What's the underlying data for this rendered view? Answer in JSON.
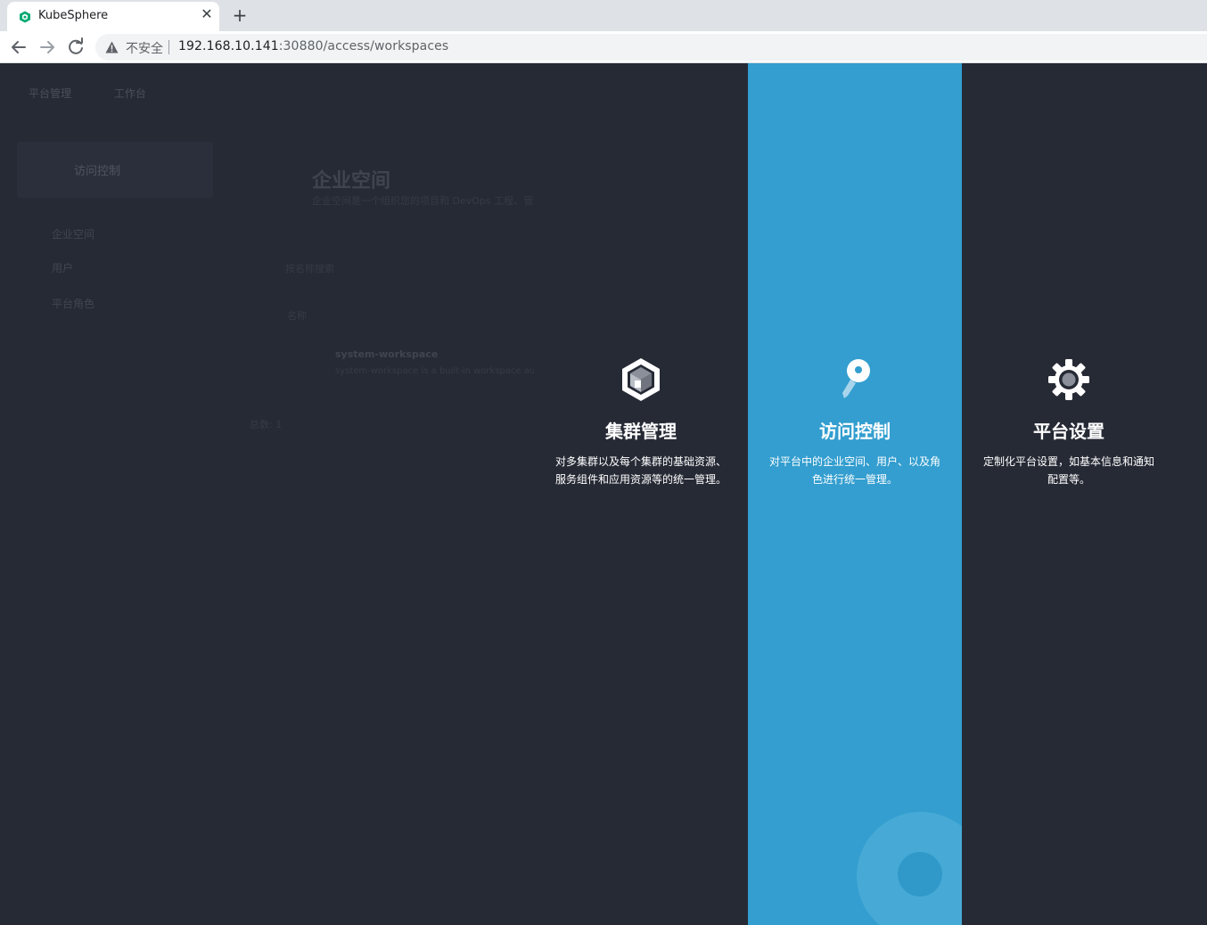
{
  "browser": {
    "tab_title": "KubeSphere",
    "tab_close": "✕",
    "new_tab": "+",
    "security_label": "不安全",
    "url_host": "192.168.10.141",
    "url_rest": ":30880/access/workspaces"
  },
  "background_app": {
    "top_nav": [
      "平台管理",
      "工作台"
    ],
    "sidebar_card": "访问控制",
    "sidebar_items": [
      "企业空间",
      "用户",
      "平台角色"
    ],
    "header_title": "企业空间",
    "header_desc": "企业空间是一个组织您的项目和 DevOps 工程、管理资源访问权限以及在团队内部共享资源等的逻辑单元，可以作为团队工作的独立工作空间。",
    "search_placeholder": "按名称搜索",
    "column_name": "名称",
    "row_name": "system-workspace",
    "row_desc": "system-workspace is a built-in workspace automatically created by KubeSphere.",
    "total": "总数: 1"
  },
  "panels": [
    {
      "icon": "cluster-cube-icon",
      "title": "集群管理",
      "description": "对多集群以及每个集群的基础资源、服务组件和应用资源等的统一管理。"
    },
    {
      "icon": "key-icon",
      "title": "访问控制",
      "description": "对平台中的企业空间、用户、以及角色进行统一管理。"
    },
    {
      "icon": "gear-icon",
      "title": "平台设置",
      "description": "定制化平台设置，如基本信息和通知配置等。"
    }
  ],
  "colors": {
    "page_background": "#262a35",
    "active_panel": "#339ecf",
    "favicon": "#00aa72"
  }
}
